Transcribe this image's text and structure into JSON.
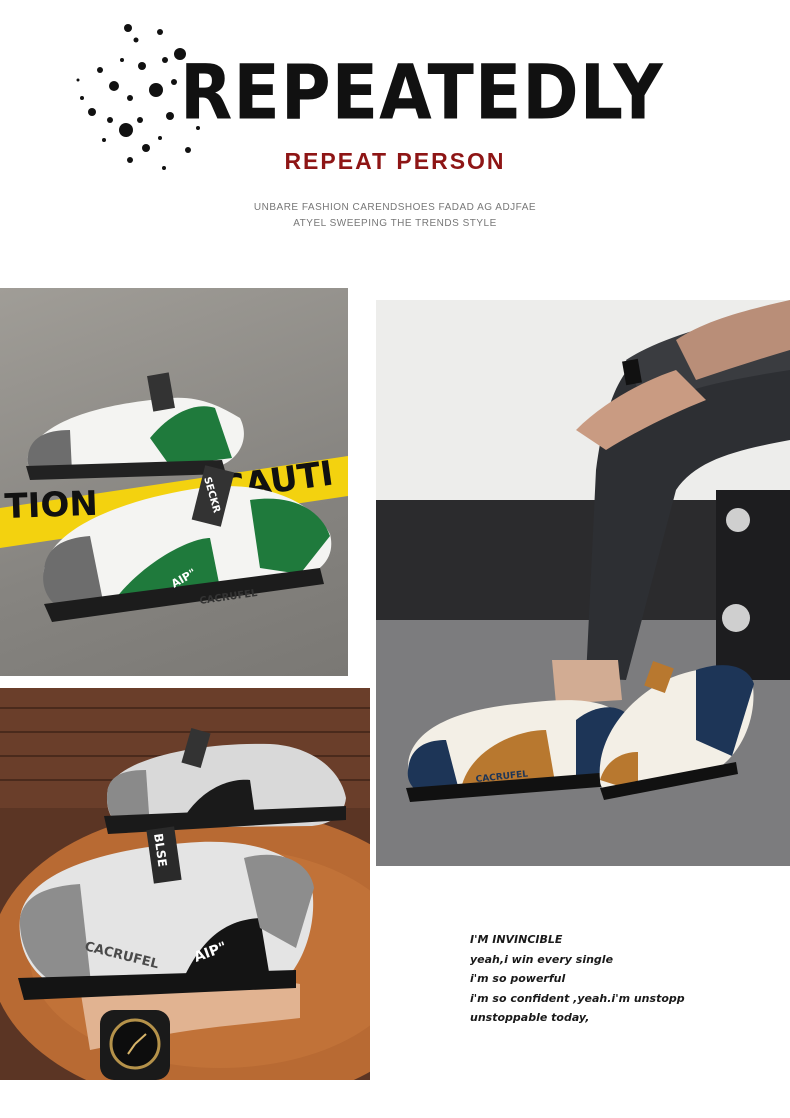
{
  "header": {
    "title": "REPEATEDLY",
    "subtitle": "REPEAT PERSON",
    "tagline_line1": "UNBARE FASHION CARENDSHOES FADAD AG ADJFAE",
    "tagline_line2": "ATYEL SWEEPING THE TRENDS STYLE"
  },
  "photos": {
    "green_shoes": {
      "tape_text": "CAUTI",
      "tape_text_left": "TION",
      "tongue_text": "SECKR",
      "side_text": "CACRUFEL",
      "logo_text": "AIP\""
    },
    "worn_shoes": {
      "side_text": "CACRUFEL"
    },
    "grey_shoes": {
      "tongue_text": "BLSE",
      "side_text": "CACRUFEL",
      "logo_text": "AIP\""
    }
  },
  "lyrics": [
    "I'M INVINCIBLE",
    "yeah,i win every single",
    "i'm so powerful",
    "i'm so confident ,yeah.i'm unstopp",
    "unstoppable today,"
  ],
  "colors": {
    "accent_red": "#8e1515",
    "shoe_green": "#1f7a3c",
    "shoe_navy": "#1d3557",
    "shoe_tan": "#b8782f",
    "caution_yellow": "#f3d20f"
  }
}
